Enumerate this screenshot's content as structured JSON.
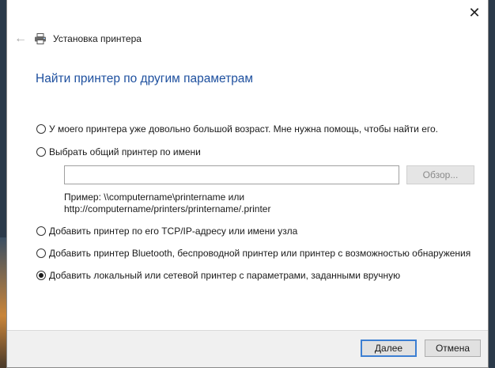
{
  "window": {
    "close_glyph": "✕",
    "back_glyph": "←",
    "title": "Установка принтера"
  },
  "heading": "Найти принтер по другим параметрам",
  "options": [
    {
      "label": "У моего принтера уже довольно большой возраст. Мне нужна помощь, чтобы найти его.",
      "checked": false
    },
    {
      "label": "Выбрать общий принтер по имени",
      "checked": false
    },
    {
      "label": "Добавить принтер по его TCP/IP-адресу или имени узла",
      "checked": false
    },
    {
      "label": "Добавить принтер Bluetooth, беспроводной принтер или принтер с возможностью обнаружения",
      "checked": false
    },
    {
      "label": "Добавить локальный или сетевой принтер с параметрами, заданными вручную",
      "checked": true
    }
  ],
  "shared_printer": {
    "input_value": "",
    "browse_label": "Обзор...",
    "example_line1": "Пример: \\\\computername\\printername или",
    "example_line2": "http://computername/printers/printername/.printer"
  },
  "footer": {
    "next_label": "Далее",
    "cancel_label": "Отмена"
  },
  "colors": {
    "heading": "#1d4f9e",
    "default_button_border": "#3c7fd2"
  }
}
